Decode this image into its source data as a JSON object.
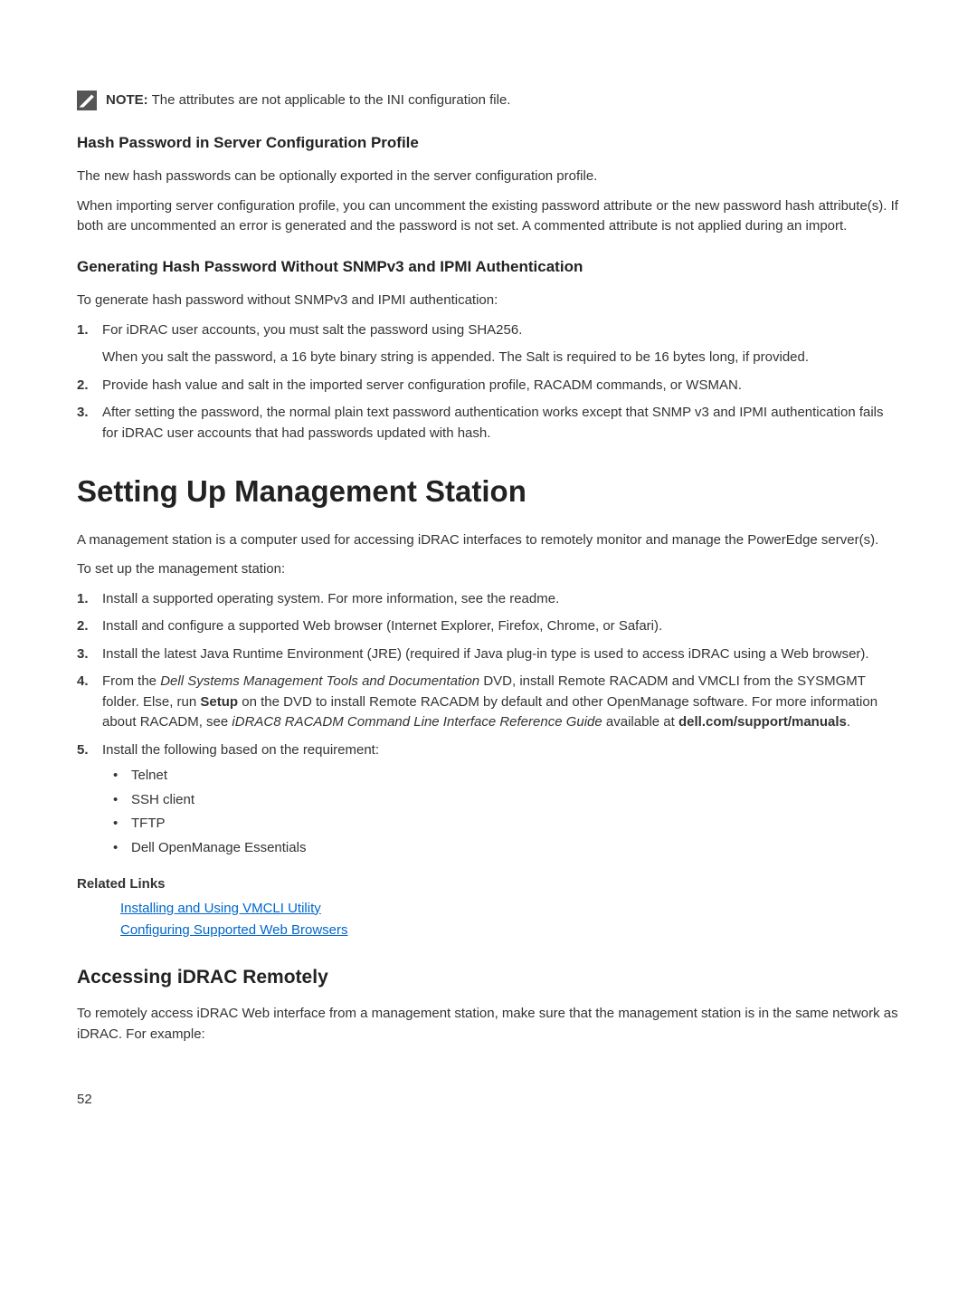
{
  "note": {
    "label": "NOTE:",
    "text": " The attributes are not applicable to the INI configuration file."
  },
  "hash_section": {
    "heading": "Hash Password in Server Configuration Profile",
    "p1": "The new hash passwords can be optionally exported in the server configuration profile.",
    "p2": "When importing server configuration profile, you can uncomment the existing password attribute or the new password hash attribute(s). If both are uncommented an error is generated and the password is not set. A commented attribute is not applied during an import."
  },
  "gen_section": {
    "heading": "Generating Hash Password Without SNMPv3 and IPMI Authentication",
    "intro": "To generate hash password without SNMPv3 and IPMI authentication:",
    "items": [
      {
        "num": "1.",
        "text": "For iDRAC user accounts, you must salt the password using SHA256.",
        "sub": "When you salt the password, a 16 byte binary string is appended. The Salt is required to be 16 bytes long, if provided."
      },
      {
        "num": "2.",
        "text": "Provide hash value and salt in the imported server configuration profile, RACADM commands, or WSMAN."
      },
      {
        "num": "3.",
        "text": "After setting the password, the normal plain text password authentication works except that SNMP v3 and IPMI authentication fails for iDRAC user accounts that had passwords updated with hash."
      }
    ]
  },
  "mgmt_section": {
    "heading": "Setting Up Management Station",
    "p1": "A management station is a computer used for accessing iDRAC interfaces to remotely monitor and manage the PowerEdge server(s).",
    "p2": "To set up the management station:",
    "items": {
      "i1": {
        "num": "1.",
        "text": "Install a supported operating system. For more information, see the readme."
      },
      "i2": {
        "num": "2.",
        "text": "Install and configure a supported Web browser (Internet Explorer, Firefox, Chrome, or Safari)."
      },
      "i3": {
        "num": "3.",
        "text": "Install the latest Java Runtime Environment (JRE) (required if Java plug-in type is used to access iDRAC using a Web browser)."
      },
      "i4": {
        "num": "4.",
        "pre": "From the ",
        "italic1": "Dell Systems Management Tools and Documentation",
        "mid1": " DVD, install Remote RACADM and VMCLI from the SYSMGMT folder. Else, run ",
        "bold1": "Setup",
        "mid2": " on the DVD to install Remote RACADM by default and other OpenManage software. For more information about RACADM, see ",
        "italic2": "iDRAC8 RACADM Command Line Interface Reference Guide",
        "mid3": " available at ",
        "bold2": "dell.com/support/manuals",
        "post": "."
      },
      "i5": {
        "num": "5.",
        "text": "Install the following based on the requirement:",
        "bullets": [
          "Telnet",
          "SSH client",
          "TFTP",
          "Dell OpenManage Essentials"
        ]
      }
    },
    "related_heading": "Related Links",
    "links": [
      "Installing and Using VMCLI Utility",
      "Configuring Supported Web Browsers"
    ]
  },
  "access_section": {
    "heading": "Accessing iDRAC Remotely",
    "p1": "To remotely access iDRAC Web interface from a management station, make sure that the management station is in the same network as iDRAC. For example:"
  },
  "page_number": "52"
}
